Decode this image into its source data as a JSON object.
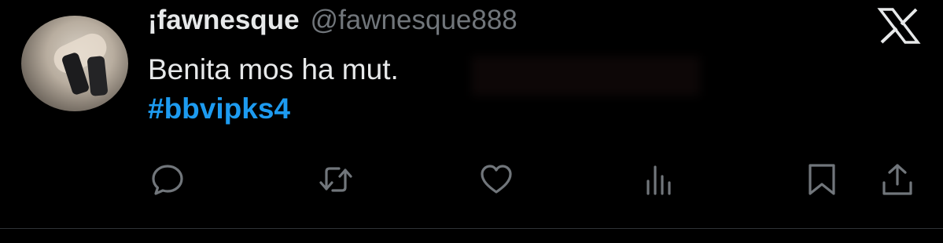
{
  "tweet": {
    "author": {
      "display_name": "¡fawnesque",
      "handle": "@fawnesque888"
    },
    "text": "Benita mos ha mut.",
    "hashtag": "#bbvipks4"
  },
  "icons": {
    "platform_logo": "x-logo-icon",
    "actions": [
      "reply-icon",
      "retweet-icon",
      "like-icon",
      "views-icon",
      "bookmark-icon",
      "share-icon"
    ]
  },
  "colors": {
    "background": "#000000",
    "text_primary": "#e7e9ea",
    "text_secondary": "#71767b",
    "accent": "#1d9bf0",
    "icon": "#71767b"
  }
}
